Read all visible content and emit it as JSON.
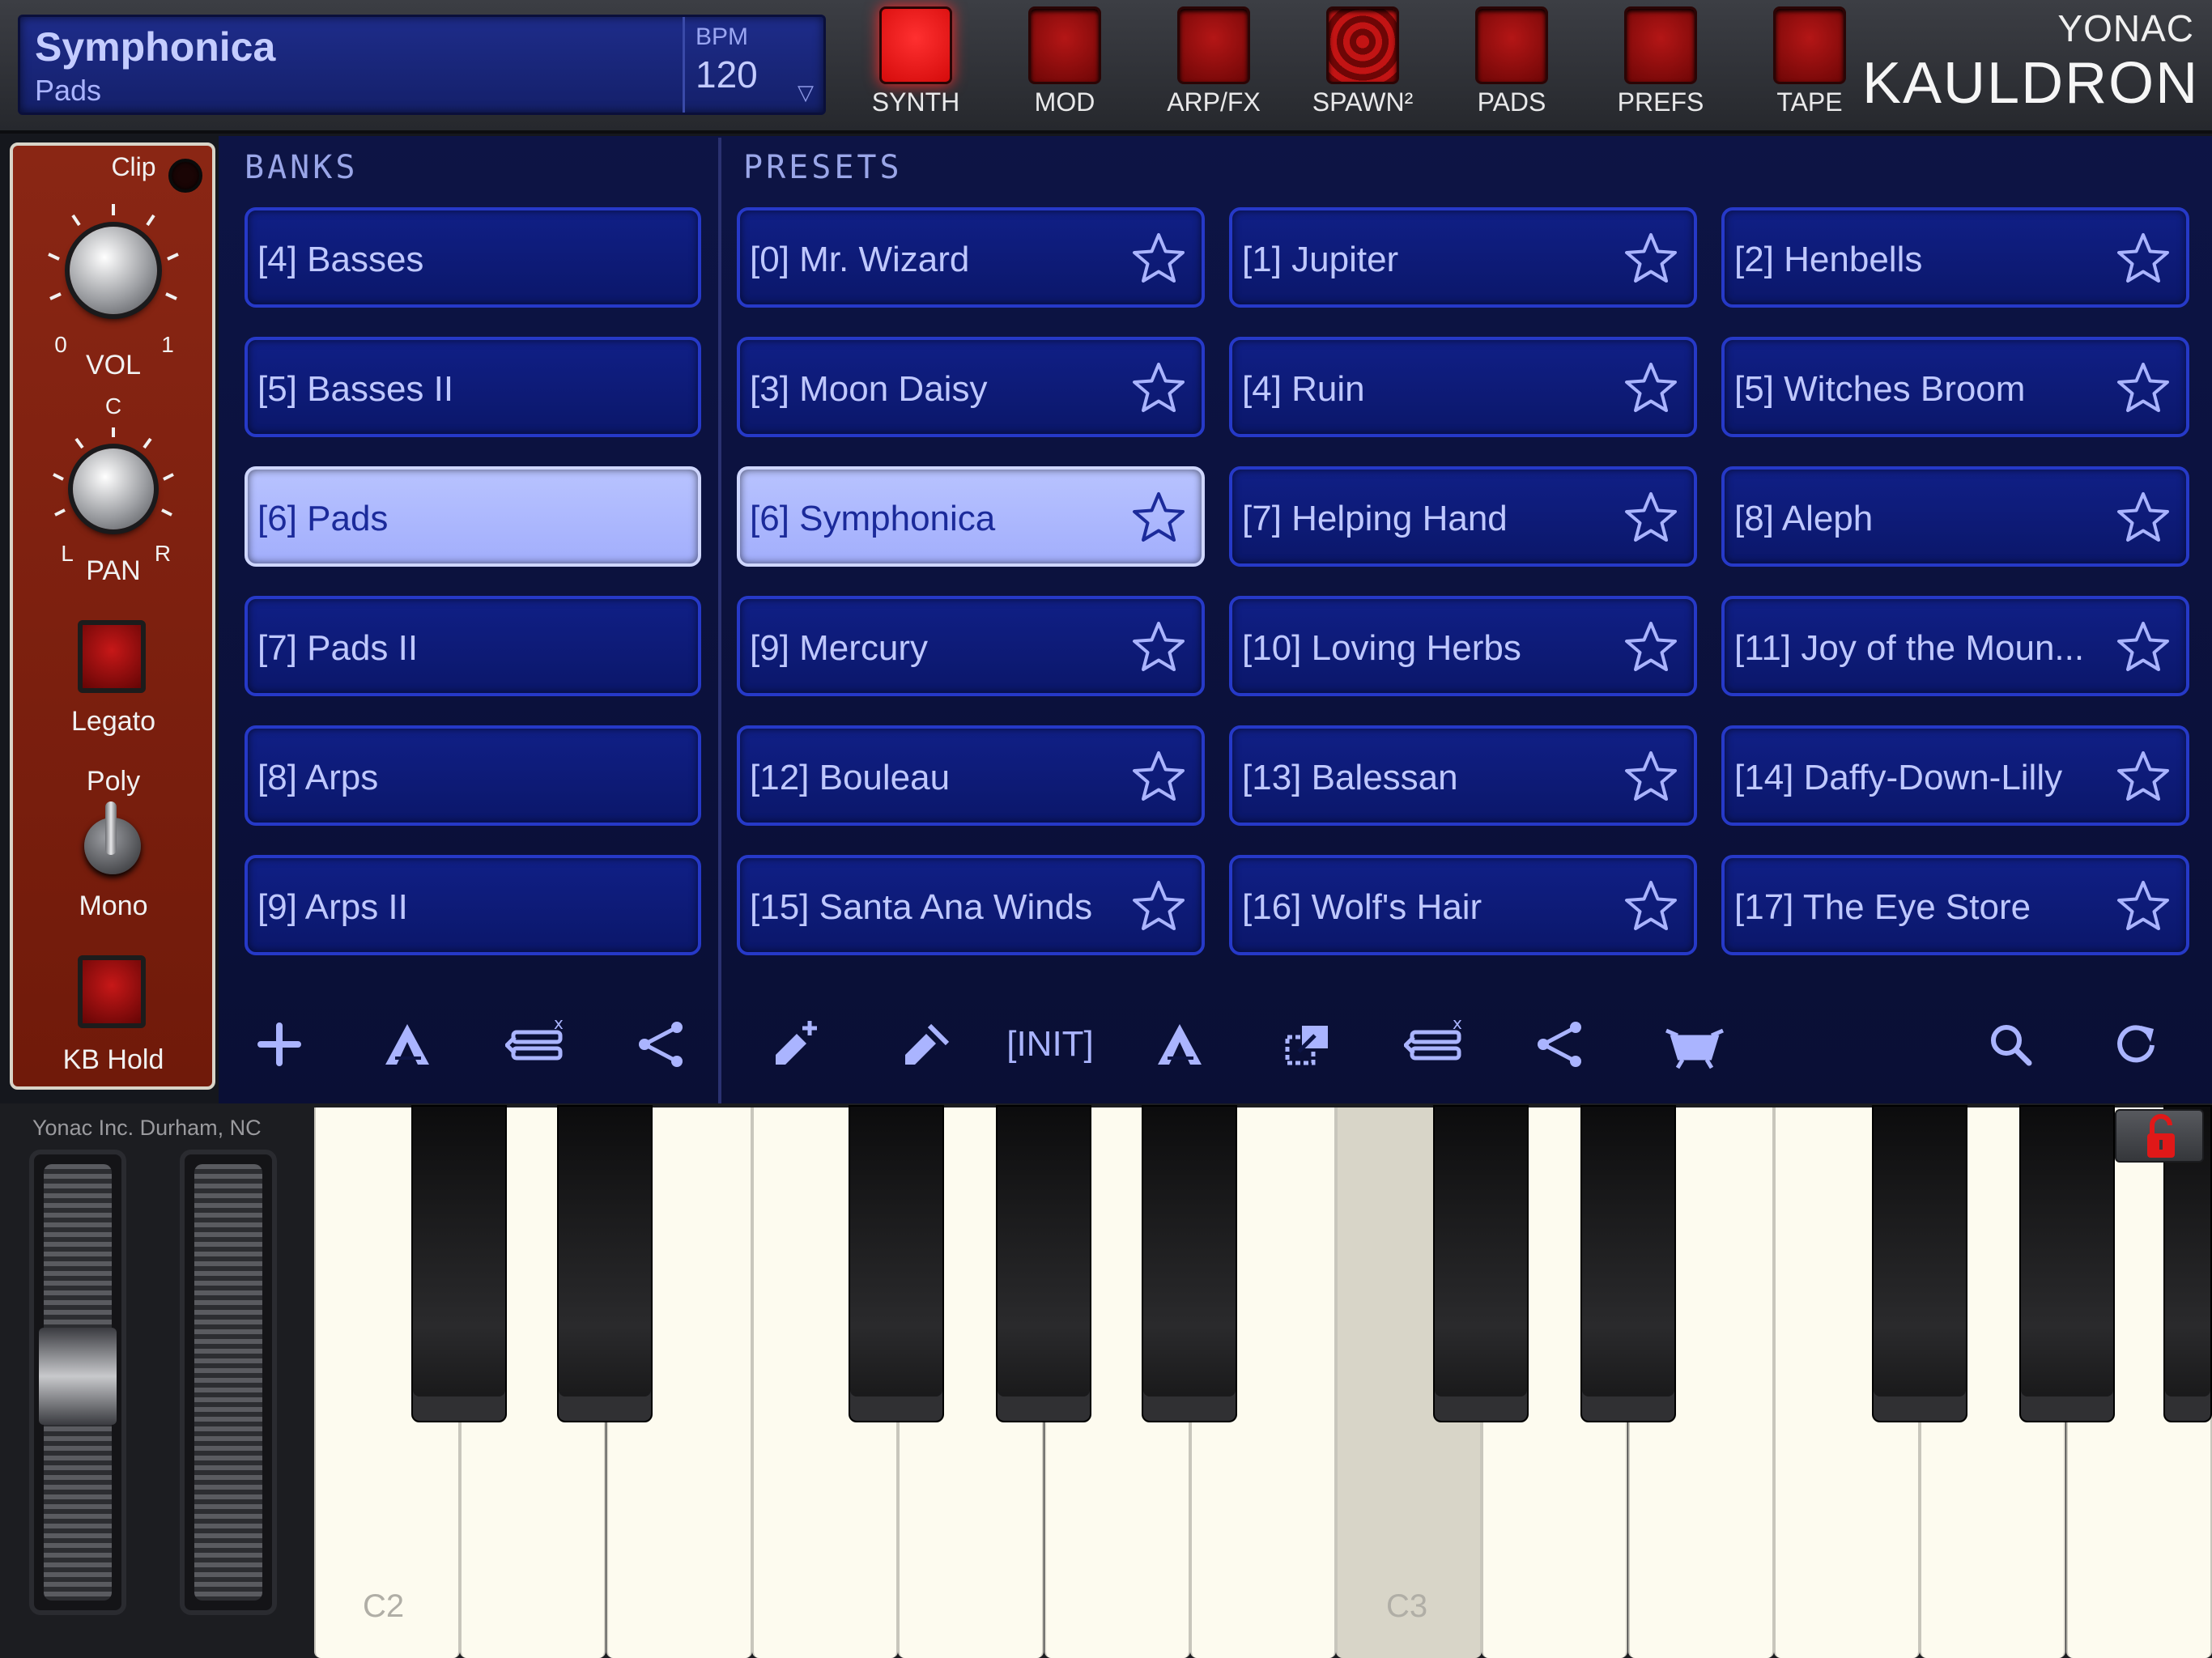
{
  "header": {
    "patch_name": "Symphonica",
    "bank_name": "Pads",
    "bpm_label": "BPM",
    "bpm_value": "120",
    "nav": [
      {
        "label": "SYNTH",
        "active": true
      },
      {
        "label": "MOD",
        "active": false
      },
      {
        "label": "ARP/FX",
        "active": false
      },
      {
        "label": "SPAWN²",
        "active": false
      },
      {
        "label": "PADS",
        "active": false
      },
      {
        "label": "PREFS",
        "active": false
      },
      {
        "label": "TAPE",
        "active": false
      }
    ],
    "brand_top": "YONAC",
    "brand_main": "KAULDRON"
  },
  "left_panel": {
    "clip_label": "Clip",
    "vol_label": "VOL",
    "vol_min": "0",
    "vol_max": "1",
    "pan_label": "PAN",
    "pan_center": "C",
    "pan_left": "L",
    "pan_right": "R",
    "legato_label": "Legato",
    "poly_label": "Poly",
    "mono_label": "Mono",
    "kbhold_label": "KB Hold"
  },
  "banks": {
    "title": "BANKS",
    "items": [
      "[4] Basses",
      "[5] Basses II",
      "[6] Pads",
      "[7] Pads II",
      "[8] Arps",
      "[9] Arps II"
    ],
    "selected_index": 2
  },
  "presets": {
    "title": "PRESETS",
    "items": [
      "[0] Mr. Wizard",
      "[1] Jupiter",
      "[2] Henbells",
      "[3] Moon Daisy",
      "[4] Ruin",
      "[5] Witches Broom",
      "[6] Symphonica",
      "[7] Helping Hand",
      "[8] Aleph",
      "[9] Mercury",
      "[10] Loving Herbs",
      "[11] Joy of the Moun...",
      "[12] Bouleau",
      "[13] Balessan",
      "[14] Daffy-Down-Lilly",
      "[15] Santa Ana Winds",
      "[16] Wolf's Hair",
      "[17] The Eye Store"
    ],
    "selected_index": 6
  },
  "toolbar": {
    "init_label": "[INIT]"
  },
  "keyboard": {
    "maker_text": "Yonac Inc. Durham, NC",
    "label_c2": "C2",
    "label_c3": "C3"
  },
  "colors": {
    "accent_red": "#ff2b2b",
    "tile_blue": "#0b176a",
    "selected_tile": "#b8c3ff"
  }
}
